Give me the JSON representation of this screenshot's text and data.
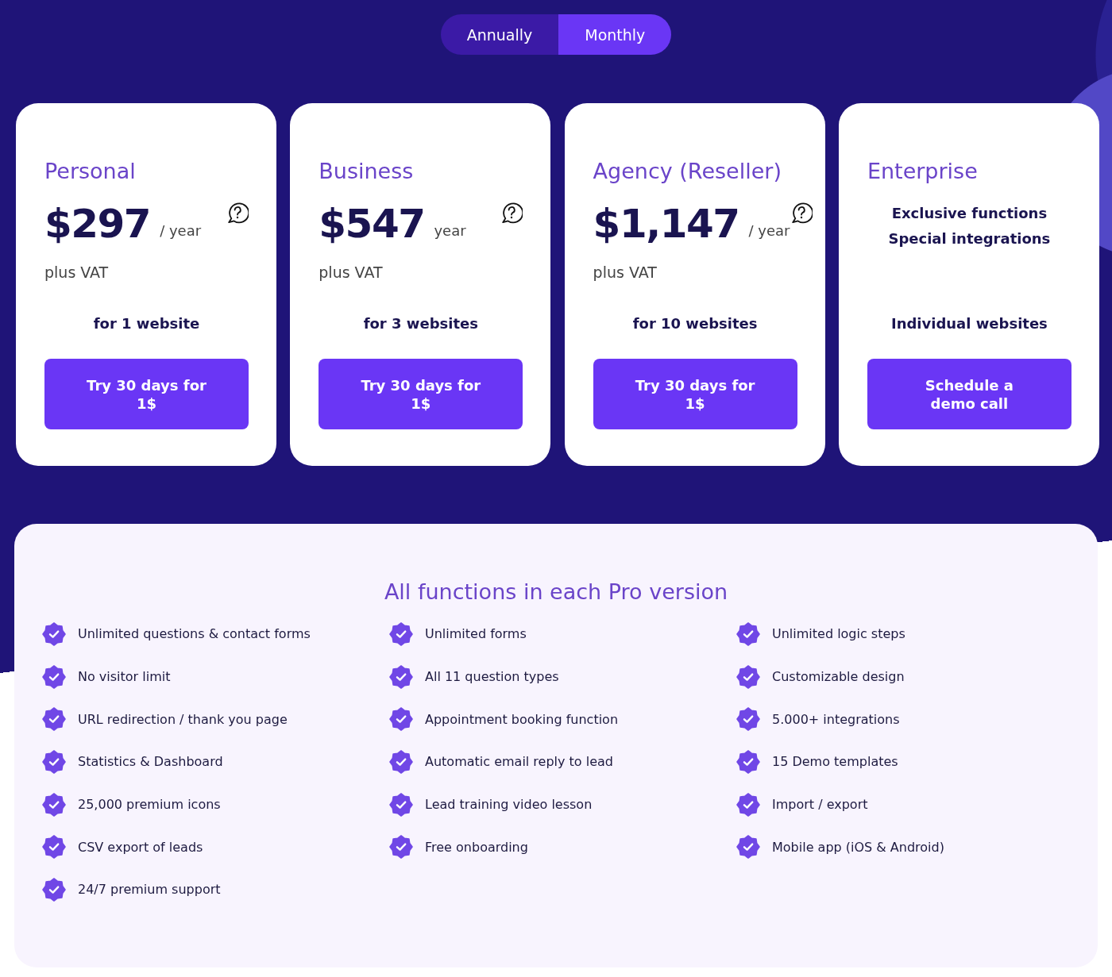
{
  "billing_toggle": [
    {
      "label": "Annually",
      "selected": false
    },
    {
      "label": "Monthly",
      "selected": true
    }
  ],
  "plans": [
    {
      "kind": "priced",
      "name": "Personal",
      "price": "$297",
      "period": "/ year",
      "tax_note": "plus VAT",
      "sites": "for 1 website",
      "button": "Try 30 days for 1$"
    },
    {
      "kind": "priced",
      "name": "Business",
      "price": "$547",
      "period": "year",
      "tax_note": "plus VAT",
      "sites": "for 3 websites",
      "button": "Try 30 days for 1$"
    },
    {
      "kind": "priced",
      "name": "Agency (Reseller)",
      "price": "$1,147",
      "period": "/ year",
      "tax_note": "plus VAT",
      "sites": "for 10 websites",
      "button": "Try 30 days for 1$"
    },
    {
      "kind": "custom",
      "name": "Enterprise",
      "highlights": [
        "Exclusive functions",
        "Special integrations"
      ],
      "sites": "Individual websites",
      "button": "Schedule a demo call"
    }
  ],
  "features": {
    "title": "All functions in each Pro version",
    "columns": [
      [
        "Unlimited questions & contact forms",
        "No visitor limit",
        "URL redirection / thank you page",
        "Statistics & Dashboard",
        "25,000 premium icons",
        "CSV export of leads",
        "24/7 premium support"
      ],
      [
        "Unlimited forms",
        "All 11 question types",
        "Appointment booking function",
        "Automatic email reply to lead",
        "Lead training video lesson",
        "Free onboarding"
      ],
      [
        "Unlimited logic steps",
        "Customizable design",
        "5.000+ integrations",
        "15 Demo templates",
        "Import / export",
        "Mobile app (iOS & Android)"
      ]
    ]
  }
}
